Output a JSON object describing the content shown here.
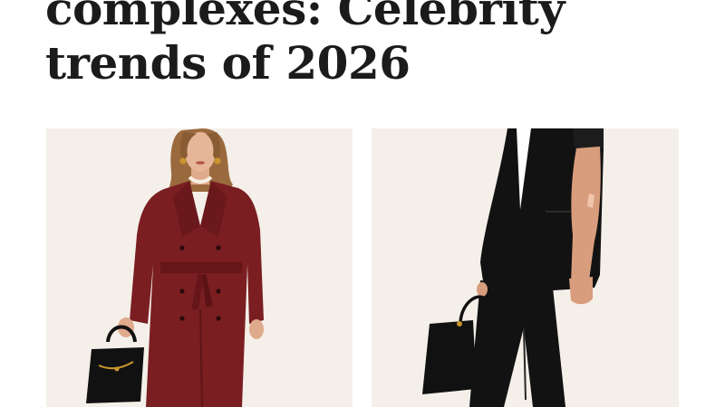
{
  "article": {
    "headline_line1": "complexes: Celebrity",
    "headline_line2": "trends of 2026"
  },
  "illustrations": [
    {
      "name": "burgundy-trench-coat-figure",
      "background": "#f4efe8",
      "coat_color": "#7a1e22",
      "bag_color": "#111111"
    },
    {
      "name": "black-suit-figure",
      "background": "#f4efe8",
      "suit_color": "#121212",
      "bag_color": "#111111"
    }
  ],
  "colors": {
    "headline": "#1b1b1b",
    "skin": "#e0aa8c",
    "hair": "#9a6a3e",
    "gold": "#c9962e"
  }
}
